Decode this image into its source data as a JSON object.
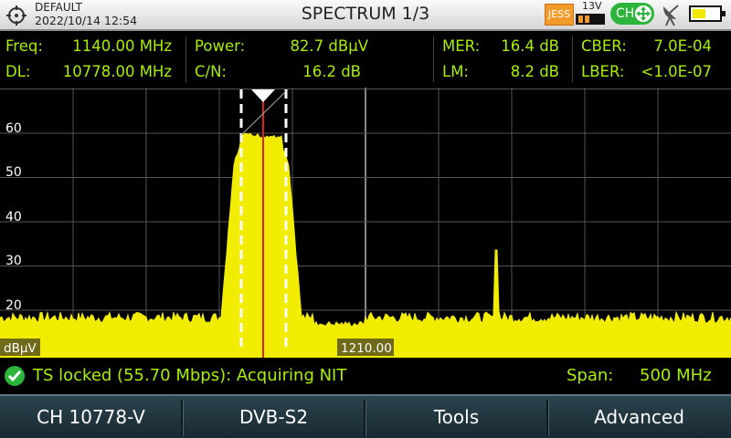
{
  "title_bar": {
    "profile": "DEFAULT",
    "timestamp": "2022/10/14 12:54",
    "title": "SPECTRUM 1/3",
    "jess_badge": "JESS",
    "lnb_voltage": "13V",
    "ch_badge": "CH",
    "icons": [
      "target-icon",
      "satellite-dish-icon",
      "battery-icon",
      "move-arrows-icon"
    ]
  },
  "measurements": {
    "freq_label": "Freq:",
    "freq_value": "1140.00 MHz",
    "dl_label": "DL:",
    "dl_value": "10778.00 MHz",
    "power_label": "Power:",
    "power_value": "82.7 dBµV",
    "cn_label": "C/N:",
    "cn_value": "16.2 dB",
    "mer_label": "MER:",
    "mer_value": "16.4 dB",
    "lm_label": "LM:",
    "lm_value": "8.2 dB",
    "cber_label": "CBER:",
    "cber_value": "7.0E-04",
    "lber_label": "LBER:",
    "lber_value": "<1.0E-07"
  },
  "spectrum": {
    "y_ticks": [
      "60",
      "50",
      "40",
      "30",
      "20"
    ],
    "unit": "dBµV",
    "center_freq_label": "1210.00",
    "colors": {
      "trace": "#f2ec00",
      "grid": "#555555",
      "marker": "#e02020",
      "text": "#ffffff"
    }
  },
  "status": {
    "message": "TS locked (55.70 Mbps): Acquiring NIT",
    "span_label": "Span:",
    "span_value": "500 MHz",
    "icon": "check-circle-icon"
  },
  "softkeys": [
    "CH 10778-V",
    "DVB-S2",
    "Tools",
    "Advanced"
  ]
}
